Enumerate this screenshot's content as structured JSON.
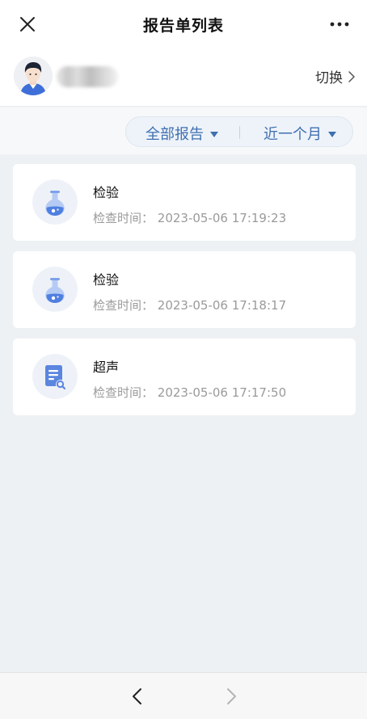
{
  "header": {
    "title": "报告单列表"
  },
  "user": {
    "switch_label": "切换"
  },
  "filters": {
    "type": "全部报告",
    "period": "近一个月"
  },
  "reports": [
    {
      "title": "检验",
      "time_label": "检查时间：",
      "time": "2023-05-06 17:19:23",
      "icon": "flask-icon"
    },
    {
      "title": "检验",
      "time_label": "检查时间：",
      "time": "2023-05-06 17:18:17",
      "icon": "flask-icon"
    },
    {
      "title": "超声",
      "time_label": "检查时间：",
      "time": "2023-05-06 17:17:50",
      "icon": "document-search-icon"
    }
  ],
  "colors": {
    "accent": "#3f6fb0",
    "icon_blue": "#5b86e0",
    "background": "#eef1f4"
  }
}
